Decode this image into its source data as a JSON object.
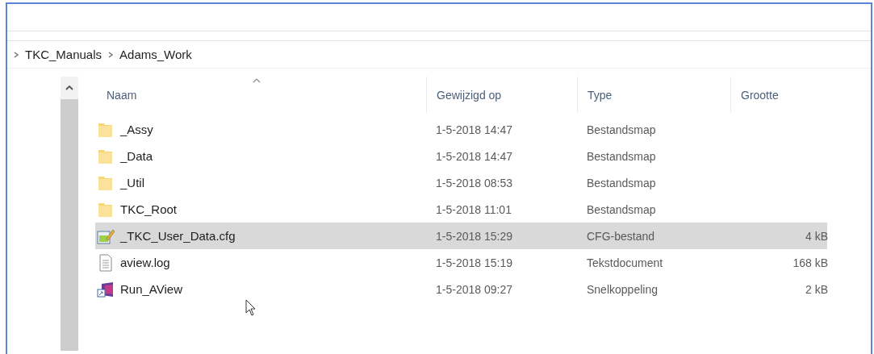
{
  "breadcrumb": [
    "TKC_Manuals",
    "Adams_Work"
  ],
  "columns": [
    {
      "label": "Naam",
      "sorted": true
    },
    {
      "label": "Gewijzigd op",
      "sorted": false
    },
    {
      "label": "Type",
      "sorted": false
    },
    {
      "label": "Grootte",
      "sorted": false
    }
  ],
  "files": [
    {
      "kind": "folder",
      "name": "_Assy",
      "modified": "1-5-2018 14:47",
      "type": "Bestandsmap",
      "selected": false
    },
    {
      "kind": "folder",
      "name": "_Data",
      "modified": "1-5-2018 14:47",
      "type": "Bestandsmap",
      "selected": false
    },
    {
      "kind": "folder",
      "name": "_Util",
      "modified": "1-5-2018 08:53",
      "type": "Bestandsmap",
      "selected": false
    },
    {
      "kind": "folder",
      "name": "TKC_Root",
      "modified": "1-5-2018 11:01",
      "type": "Bestandsmap",
      "selected": false
    },
    {
      "kind": "config",
      "name": "_TKC_User_Data.cfg",
      "modified": "1-5-2018 15:29",
      "type": "CFG-bestand",
      "size": "4 kB",
      "selected": true
    },
    {
      "kind": "text",
      "name": "aview.log",
      "modified": "1-5-2018 15:19",
      "type": "Tekstdocument",
      "size": "168 kB",
      "selected": false
    },
    {
      "kind": "shortcut",
      "name": "Run_AView",
      "modified": "1-5-2018 09:27",
      "type": "Snelkoppeling",
      "size": "2 kB",
      "selected": false
    }
  ]
}
